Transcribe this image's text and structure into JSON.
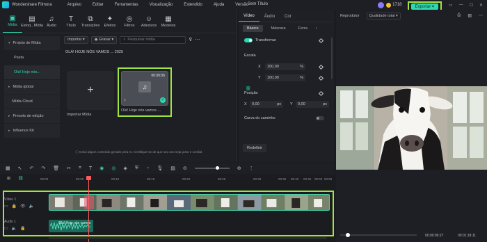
{
  "app": {
    "name": "Wondershare Filmora",
    "menu": [
      "Arquivo",
      "Editar",
      "Ferramentas",
      "Visualização",
      "Estendido",
      "Ajuda",
      "Versão"
    ],
    "doc_title": "Sem Título",
    "credits": "1718",
    "export_label": "Exportar"
  },
  "toolbar": {
    "items": [
      {
        "label": "Mídia",
        "icon": "media-icon"
      },
      {
        "label": "Estoq...Mídia",
        "icon": "stock-media-icon"
      },
      {
        "label": "Áudio",
        "icon": "audio-icon"
      },
      {
        "label": "Título",
        "icon": "title-icon"
      },
      {
        "label": "Transições",
        "icon": "transitions-icon"
      },
      {
        "label": "Efeitos",
        "icon": "effects-icon"
      },
      {
        "label": "Filtros",
        "icon": "filters-icon"
      },
      {
        "label": "Adesivos",
        "icon": "stickers-icon"
      },
      {
        "label": "Modelos",
        "icon": "templates-icon"
      }
    ]
  },
  "sidebar": {
    "items": [
      {
        "label": "Projeto de Mídia"
      },
      {
        "label": "Pasta"
      },
      {
        "label": "Olá! Hoje nós..."
      },
      {
        "label": "Mídia global"
      },
      {
        "label": "Mídia Cloud"
      },
      {
        "label": "Presets de edição"
      },
      {
        "label": "Influence Kit"
      }
    ]
  },
  "media": {
    "import_dropdown": "Importar",
    "record_dropdown": "Gravar",
    "search_placeholder": "Pesquisar mídia",
    "folder_label": "OLÁ! HOJE NÓS VAMOS ... 2025",
    "import_tile_label": "Importar Mídia",
    "clip_tile_label": "Olá! Hoje nós vamos ...",
    "clip_duration": "00:00:06",
    "disclaimer": "Inclui algum conteúdo gerado pela AI. Certifique-se de que seu uso seja justo e cordial."
  },
  "properties": {
    "tabs": [
      "Vídeo",
      "Áudio",
      "Cor"
    ],
    "subtabs": [
      "Básico",
      "Máscara",
      "Ferra"
    ],
    "transform_label": "Transformar",
    "scale_label": "Escala",
    "scale_x_label": "X",
    "scale_x": "100,00",
    "scale_y_label": "Y",
    "scale_y": "100,00",
    "percent_unit": "%",
    "position_label": "Posição",
    "pos_x_label": "X",
    "pos_x": "0,00",
    "pos_y_label": "Y",
    "pos_y": "0,00",
    "px_unit": "px",
    "path_curve_label": "Curva do caminho",
    "reset_label": "Redefinir"
  },
  "player": {
    "title": "Reprodutor",
    "quality": "Qualidade total",
    "current_time": "00:00:06:27",
    "total_time": "00:01:18:11",
    "progress_fraction": 0.08
  },
  "timeline": {
    "ruler_labels": [
      "00:00",
      "00:05",
      "00:10",
      "00:15",
      "00:20",
      "00:25",
      "00:30",
      "00:35",
      "00:40",
      "00:45",
      "00:50",
      "00:55"
    ],
    "video_track_label": "Vídeo 1",
    "audio_track_label": "Áudio 1",
    "audio_clip_label": "Olá! Hoje nós vamos ..."
  },
  "colors": {
    "accent": "#2fd8b0",
    "highlight": "#9fe53e",
    "playhead": "#ff5a5a"
  }
}
